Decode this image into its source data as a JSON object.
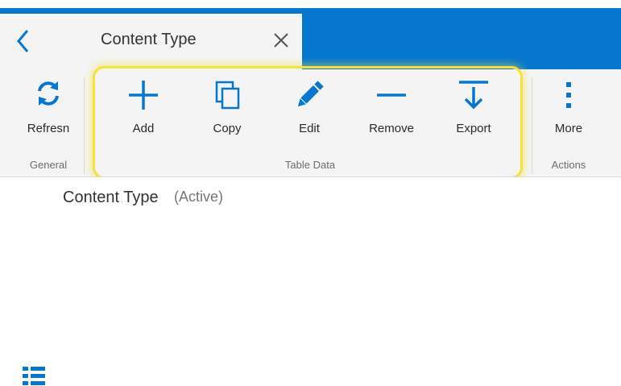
{
  "tab": {
    "title": "Content Type"
  },
  "groups": {
    "general": {
      "label": "General"
    },
    "table_data": {
      "label": "Table Data"
    },
    "actions": {
      "label": "Actions"
    }
  },
  "buttons": {
    "refresh": {
      "label": "Refresn",
      "icon": "refresh-icon"
    },
    "add": {
      "label": "Add",
      "icon": "plus-icon"
    },
    "copy": {
      "label": "Copy",
      "icon": "copy-icon"
    },
    "edit": {
      "label": "Edit",
      "icon": "pencil-icon"
    },
    "remove": {
      "label": "Remove",
      "icon": "minus-icon"
    },
    "export": {
      "label": "Export",
      "icon": "export-icon"
    },
    "more": {
      "label": "More",
      "icon": "vertical-ellipsis-icon"
    }
  },
  "status": {
    "title": "Content Type",
    "state": "(Active)"
  },
  "colors": {
    "accent": "#0677cf",
    "highlight": "#f6e13a"
  }
}
